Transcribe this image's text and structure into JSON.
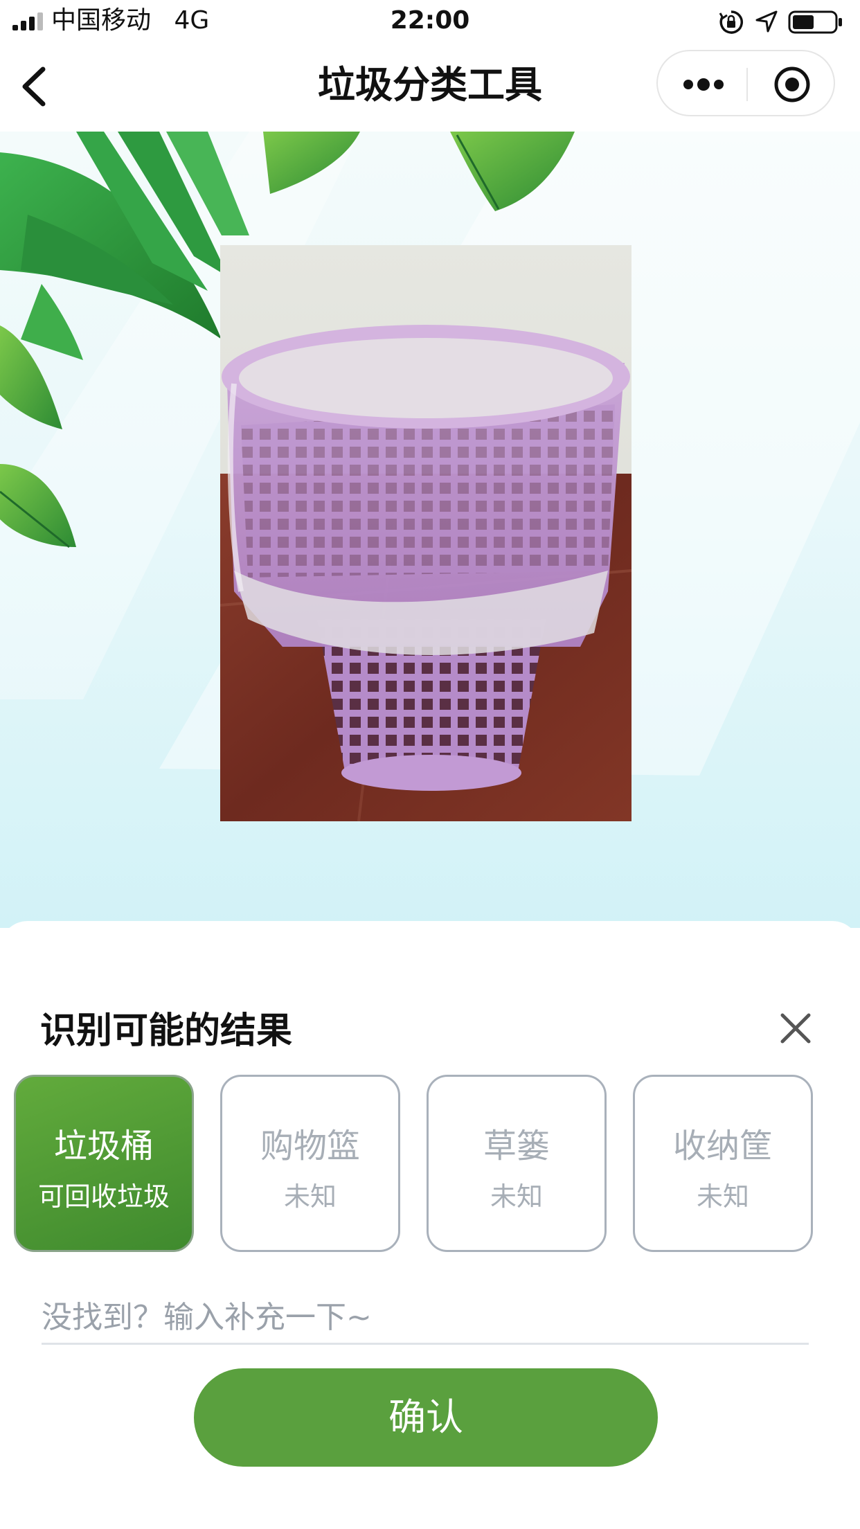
{
  "status_bar": {
    "carrier": "中国移动",
    "network": "4G",
    "time": "22:00"
  },
  "nav": {
    "title": "垃圾分类工具",
    "back_icon": "chevron-left-icon",
    "more_icon": "more-dots-icon",
    "close_icon": "target-circle-icon"
  },
  "photo": {
    "subject": "垃圾桶"
  },
  "result_sheet": {
    "title": "识别可能的结果",
    "close_icon": "close-x-icon",
    "options": [
      {
        "name": "垃圾桶",
        "category": "可回收垃圾",
        "selected": true
      },
      {
        "name": "购物篮",
        "category": "未知",
        "selected": false
      },
      {
        "name": "草篓",
        "category": "未知",
        "selected": false
      },
      {
        "name": "收纳筐",
        "category": "未知",
        "selected": false
      }
    ],
    "supplement_placeholder": "没找到？输入补充一下~",
    "supplement_value": "",
    "confirm_label": "确认"
  },
  "colors": {
    "accent": "#5aa03e",
    "selected_gradient_start": "#62ab3c",
    "selected_gradient_end": "#3f8a2e",
    "option_border": "#a9b1bb",
    "muted_text": "#a7aeb6",
    "banner_bg": "#d2f2f7"
  }
}
